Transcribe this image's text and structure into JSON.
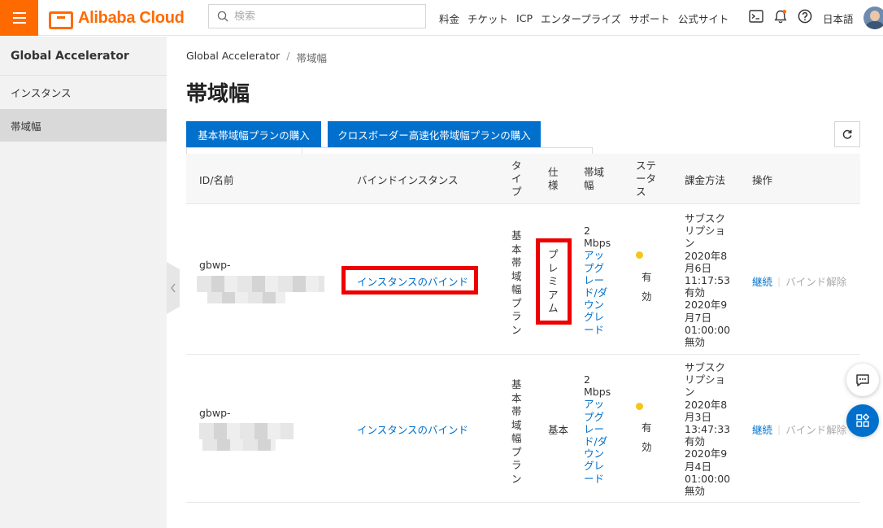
{
  "app": {
    "logo_text": "Alibaba Cloud",
    "search_placeholder": "検索",
    "nav": [
      "料金",
      "チケット",
      "ICP",
      "エンタープライズ",
      "サポート",
      "公式サイト"
    ],
    "language": "日本語"
  },
  "sidebar": {
    "title": "Global Accelerator",
    "items": [
      {
        "label": "インスタンス",
        "active": false
      },
      {
        "label": "帯域幅",
        "active": true
      }
    ]
  },
  "breadcrumb": {
    "root": "Global Accelerator",
    "separator": "/",
    "current": "帯域幅"
  },
  "page": {
    "title": "帯域幅"
  },
  "toolbar": {
    "buy_basic_label": "基本帯域幅プランの購入",
    "buy_cross_border_label": "クロスボーダー高速化帯域幅プランの購入"
  },
  "table": {
    "headers": {
      "id_name": "ID/名前",
      "bind_instance": "バインドインスタンス",
      "type": [
        "タ",
        "イ",
        "プ"
      ],
      "spec": [
        "仕",
        "様"
      ],
      "bandwidth": [
        "帯域",
        "幅"
      ],
      "status": [
        "ステ",
        "ータ",
        "ス"
      ],
      "billing": "課金方法",
      "actions": "操作"
    },
    "rows": [
      {
        "id_prefix": "gbwp-",
        "bind_link": "インスタンスのバインド",
        "type_chars": [
          "基",
          "本",
          "帯",
          "域",
          "幅",
          "プ",
          "ラ",
          "ン"
        ],
        "spec_chars": [
          "プ",
          "レ",
          "ミ",
          "ア",
          "ム"
        ],
        "bandwidth_value": "2",
        "bandwidth_unit": "Mbps",
        "upgrade_lines": [
          "アッ",
          "プグ",
          "レー",
          "ド/ダ",
          "ウン",
          "グレ",
          "ード"
        ],
        "status_chars": [
          "有",
          "効"
        ],
        "billing_lines": [
          "サブスク",
          "リプショ",
          "ン",
          "2020年8",
          "月6日",
          "11:17:53",
          "有効",
          "2020年9",
          "月7日",
          "01:00:00",
          "無効"
        ],
        "action_renew": "継続",
        "action_unbind": "バインド解除"
      },
      {
        "id_prefix": "gbwp-",
        "bind_link": "インスタンスのバインド",
        "type_chars": [
          "基",
          "本",
          "帯",
          "域",
          "幅",
          "プ",
          "ラ",
          "ン"
        ],
        "spec_text": "基本",
        "bandwidth_value": "2",
        "bandwidth_unit": "Mbps",
        "upgrade_lines": [
          "アッ",
          "プグ",
          "レー",
          "ド/ダ",
          "ウン",
          "グレ",
          "ード"
        ],
        "status_chars": [
          "有",
          "効"
        ],
        "billing_lines": [
          "サブスク",
          "リプショ",
          "ン",
          "2020年8",
          "月3日",
          "13:47:33",
          "有効",
          "2020年9",
          "月4日",
          "01:00:00",
          "無効"
        ],
        "action_renew": "継続",
        "action_unbind": "バインド解除"
      }
    ]
  },
  "colors": {
    "brand": "#ff6a00",
    "primary": "#0070cc",
    "highlight": "#ee0000",
    "warning": "#f5c518"
  },
  "icons": [
    "menu-icon",
    "search-icon",
    "terminal-icon",
    "bell-icon",
    "help-icon",
    "refresh-icon",
    "chevron-left-icon",
    "chat-icon",
    "apps-icon"
  ]
}
